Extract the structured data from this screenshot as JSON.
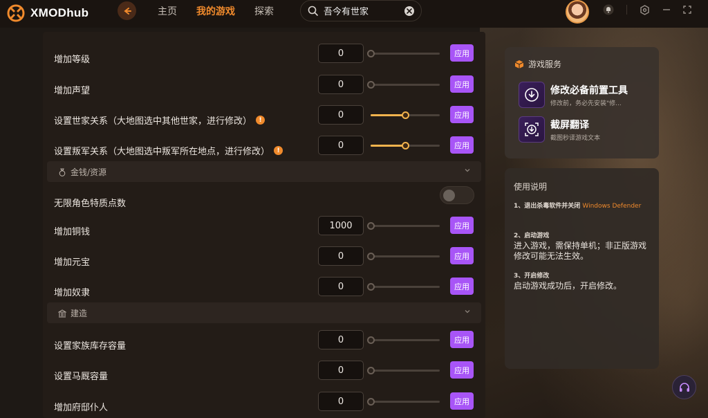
{
  "app": {
    "name": "XMODhub"
  },
  "nav": {
    "home": "主页",
    "my_games": "我的游戏",
    "explore": "探索"
  },
  "search": {
    "value": "吾今有世家"
  },
  "rows": [
    {
      "label": "增加等级",
      "value": "0",
      "level": 0,
      "apply": "应用"
    },
    {
      "label": "增加声望",
      "value": "0",
      "level": 0,
      "apply": "应用"
    },
    {
      "label": "设置世家关系（大地图选中其他世家，进行修改）",
      "value": "0",
      "level": 0.5,
      "apply": "应用",
      "info": "!"
    },
    {
      "label": "设置叛军关系（大地图选中叛军所在地点，进行修改）",
      "value": "0",
      "level": 0.5,
      "apply": "应用",
      "info": "!"
    },
    {
      "label": "增加铜钱",
      "value": "1000",
      "level": 0,
      "apply": "应用"
    },
    {
      "label": "增加元宝",
      "value": "0",
      "level": 0,
      "apply": "应用"
    },
    {
      "label": "增加奴隶",
      "value": "0",
      "level": 0,
      "apply": "应用"
    },
    {
      "label": "设置家族库存容量",
      "value": "0",
      "level": 0,
      "apply": "应用"
    },
    {
      "label": "设置马厩容量",
      "value": "0",
      "level": 0,
      "apply": "应用"
    },
    {
      "label": "增加府邸仆人",
      "value": "0",
      "level": 0,
      "apply": "应用"
    }
  ],
  "sections": {
    "money": "金钱/资源",
    "build": "建造"
  },
  "toggle_row": {
    "label": "无限角色特质点数",
    "on": false
  },
  "service": {
    "title": "游戏服务",
    "items": [
      {
        "name": "修改必备前置工具",
        "desc": "修改前，务必先安装\"修..."
      },
      {
        "name": "截屏翻译",
        "desc": "截图秒译游戏文本"
      }
    ]
  },
  "help": {
    "title": "使用说明",
    "step1": "1、退出杀毒软件并关闭",
    "step1_link": "Windows Defender",
    "step2": "2、启动游戏",
    "step2_body": "进入游戏，需保持单机；非正版游戏修改可能无法生效。",
    "step3": "3、开启修改",
    "step3_body": "启动游戏成功后，开启修改。"
  },
  "colors": {
    "accent": "#f08a2c",
    "apply": "#a855f7",
    "slider": "#f2b34d"
  }
}
